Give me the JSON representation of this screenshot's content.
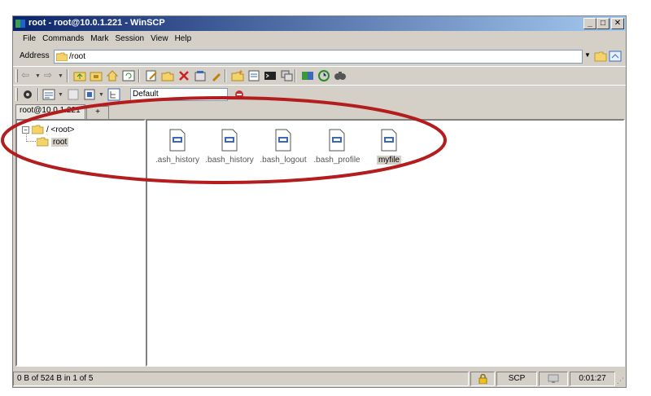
{
  "window": {
    "title": "root - root@10.0.1.221 - WinSCP"
  },
  "menu": [
    "File",
    "Commands",
    "Mark",
    "Session",
    "View",
    "Help"
  ],
  "address": {
    "label": "Address",
    "value": "/root"
  },
  "toolbar": {
    "preset_value": "Default"
  },
  "tabs": [
    {
      "label": "root@10.0.1.221"
    },
    {
      "label": "+"
    }
  ],
  "tree": {
    "root_label": "/ <root>",
    "child_label": "root"
  },
  "files": [
    {
      "name": ".ash_history",
      "selected": false
    },
    {
      "name": ".bash_history",
      "selected": false
    },
    {
      "name": ".bash_logout",
      "selected": false
    },
    {
      "name": ".bash_profile",
      "selected": false
    },
    {
      "name": "myfile",
      "selected": true
    }
  ],
  "status": {
    "summary": "0 B of 524 B in 1 of 5",
    "protocol": "SCP",
    "elapsed": "0:01:27"
  },
  "colors": {
    "annotation": "#b31d1d",
    "title_start": "#0a246a",
    "title_end": "#a6caf0"
  }
}
